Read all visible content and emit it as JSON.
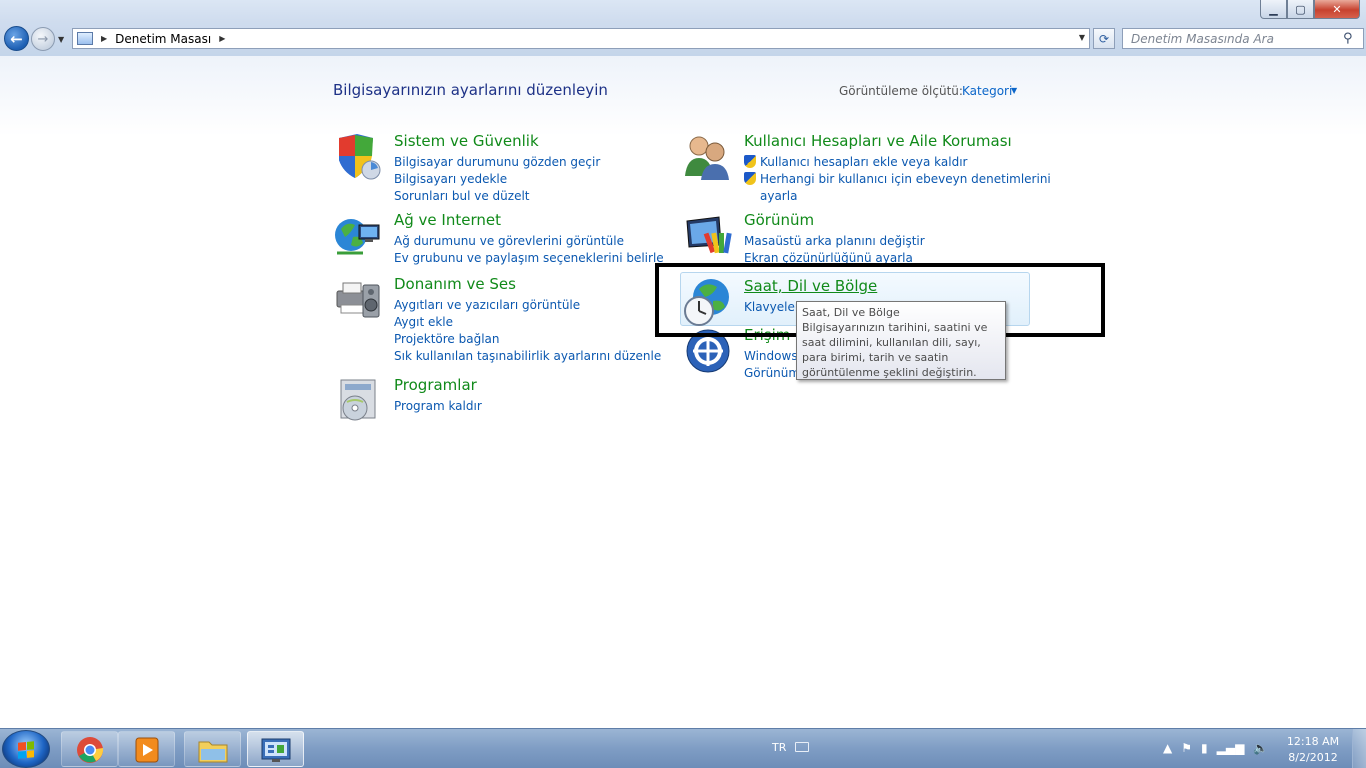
{
  "window": {
    "minimize": "▁",
    "maximize": "▢",
    "close": "✕"
  },
  "address": {
    "path": "Denetim Masası",
    "search_placeholder": "Denetim Masasında Ara"
  },
  "header": {
    "title": "Bilgisayarınızın ayarlarını düzenleyin",
    "view_by_label": "Görüntüleme ölçütü:",
    "view_by_value": "Kategori"
  },
  "categories": [
    {
      "title": "Sistem ve Güvenlik",
      "links": [
        "Bilgisayar durumunu gözden geçir",
        "Bilgisayarı yedekle",
        "Sorunları bul ve düzelt"
      ]
    },
    {
      "title": "Ağ ve Internet",
      "links": [
        "Ağ durumunu ve görevlerini görüntüle",
        "Ev grubunu ve paylaşım seçeneklerini belirle"
      ]
    },
    {
      "title": "Donanım ve Ses",
      "links": [
        "Aygıtları ve yazıcıları görüntüle",
        "Aygıt ekle",
        "Projektöre bağlan",
        "Sık kullanılan taşınabilirlik ayarlarını düzenle"
      ]
    },
    {
      "title": "Programlar",
      "links": [
        "Program kaldır"
      ]
    },
    {
      "title": "Kullanıcı Hesapları ve Aile Koruması",
      "links": [
        "Kullanıcı hesapları ekle veya kaldır",
        "Herhangi bir kullanıcı için ebeveyn denetimlerini",
        "ayarla"
      ]
    },
    {
      "title": "Görünüm",
      "links": [
        "Masaüstü arka planını değiştir",
        "Ekran çözünürlüğünü ayarla"
      ]
    },
    {
      "title": "Saat, Dil ve Bölge",
      "links": [
        "Klavyeleri"
      ]
    },
    {
      "title": "Erişim",
      "links": [
        "Windows'",
        "Görünüm"
      ]
    }
  ],
  "tooltip": {
    "title": "Saat, Dil ve Bölge",
    "body": "Bilgisayarınızın tarihini, saatini ve saat dilimini, kullanılan dili, sayı, para birimi, tarih ve saatin görüntülenme şeklini değiştirin."
  },
  "taskbar": {
    "language": "TR",
    "time": "12:18 AM",
    "date": "8/2/2012",
    "tray_icons": [
      "up-arrow-icon",
      "flag-icon",
      "power-icon",
      "signal-icon",
      "volume-icon"
    ]
  },
  "colors": {
    "category_title": "#118a1a",
    "link": "#0b58b0",
    "heading": "#1e3287"
  }
}
